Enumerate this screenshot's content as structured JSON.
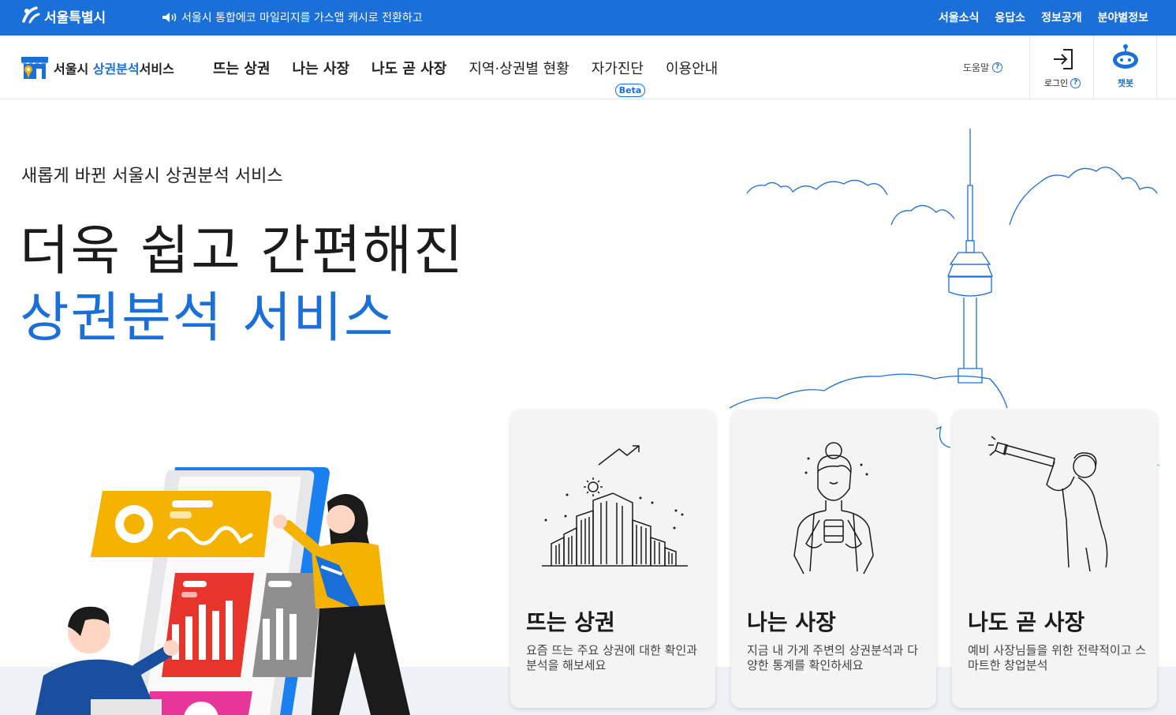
{
  "topbar": {
    "brand": "서울특별시",
    "notice": "서울시 통합에코 마일리지를 가스앱 캐시로 전환하고",
    "links": [
      "서울소식",
      "응답소",
      "정보공개",
      "분야별정보"
    ]
  },
  "header": {
    "logo_prefix": "서울시 ",
    "logo_highlight": "상권분석",
    "logo_suffix": "서비스",
    "nav": [
      "뜨는 상권",
      "나는 사장",
      "나도 곧 사장",
      "지역·상권별 현황",
      "자가진단",
      "이용안내"
    ],
    "beta_badge": "Beta",
    "help": "도움말",
    "login": "로그인",
    "chatbot": "챗봇"
  },
  "hero": {
    "subtitle": "새롭게 바뀐 서울시 상권분석 서비스",
    "title_line1": "더욱 쉽고 간편해진",
    "title_line2": "상권분석 서비스"
  },
  "cards": [
    {
      "title": "뜨는 상권",
      "desc": "요즘 뜨는 주요 상권에 대한 확인과 분석을 해보세요"
    },
    {
      "title": "나는 사장",
      "desc": "지금 내 가게 주변의 상권분석과 다양한 통계를 확인하세요"
    },
    {
      "title": "나도 곧 사장",
      "desc": "예비 사장님들을 위한 전략적이고 스마트한 창업분석"
    }
  ],
  "colors": {
    "accent": "#1a6fd9",
    "yellow": "#f5b200",
    "red": "#e8352c",
    "pink": "#e8359a"
  }
}
